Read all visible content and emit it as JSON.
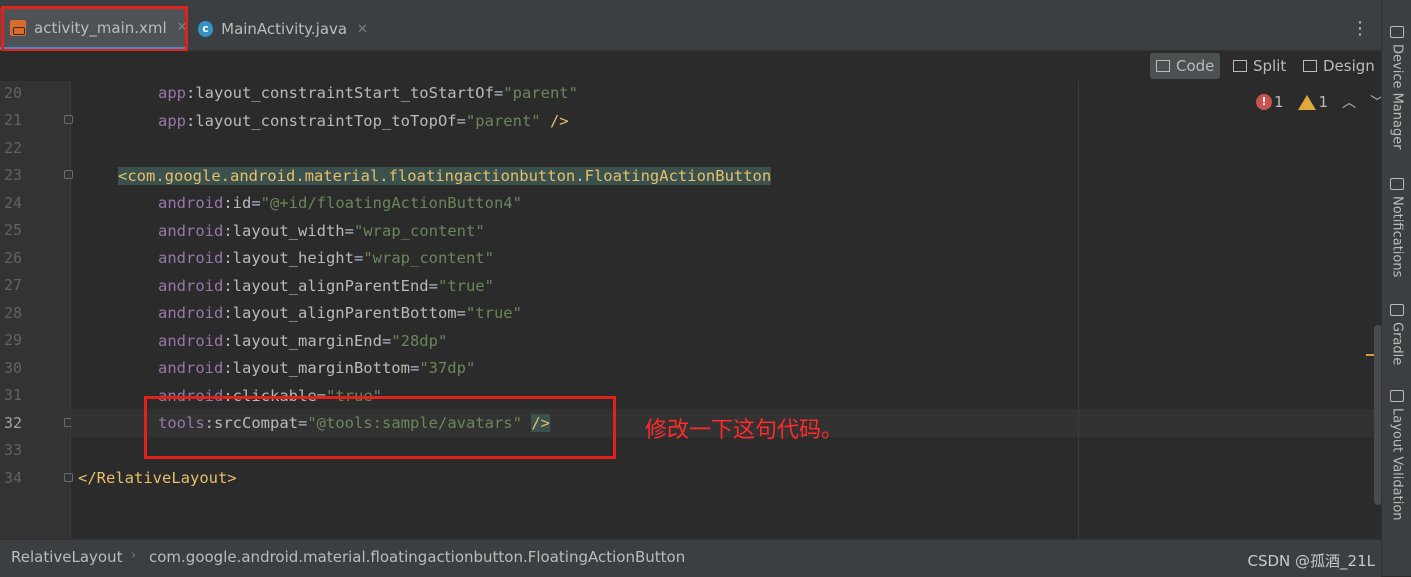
{
  "tabs": [
    {
      "label": "activity_main.xml",
      "active": true
    },
    {
      "label": "MainActivity.java",
      "active": false
    }
  ],
  "modes": [
    "Code",
    "Split",
    "Design"
  ],
  "inspection": {
    "errors": "1",
    "warnings": "1"
  },
  "line_numbers": [
    "20",
    "21",
    "22",
    "23",
    "24",
    "25",
    "26",
    "27",
    "28",
    "29",
    "30",
    "31",
    "32",
    "33",
    "34"
  ],
  "code": {
    "l20": {
      "ns": "app",
      "attr": ":layout_constraintStart_toStartOf",
      "eq": "=",
      "val": "\"parent\""
    },
    "l21": {
      "ns": "app",
      "attr": ":layout_constraintTop_toTopOf",
      "eq": "=",
      "val": "\"parent\"",
      "end": " />"
    },
    "l23": {
      "tag": "<com.google.android.material.floatingactionbutton.FloatingActionButton"
    },
    "l24": {
      "ns": "android",
      "attr": ":id",
      "eq": "=",
      "val": "\"@+id/floatingActionButton4\""
    },
    "l25": {
      "ns": "android",
      "attr": ":layout_width",
      "eq": "=",
      "val": "\"wrap_content\""
    },
    "l26": {
      "ns": "android",
      "attr": ":layout_height",
      "eq": "=",
      "val": "\"wrap_content\""
    },
    "l27": {
      "ns": "android",
      "attr": ":layout_alignParentEnd",
      "eq": "=",
      "val": "\"true\""
    },
    "l28": {
      "ns": "android",
      "attr": ":layout_alignParentBottom",
      "eq": "=",
      "val": "\"true\""
    },
    "l29": {
      "ns": "android",
      "attr": ":layout_marginEnd",
      "eq": "=",
      "val": "\"28dp\""
    },
    "l30": {
      "ns": "android",
      "attr": ":layout_marginBottom",
      "eq": "=",
      "val": "\"37dp\""
    },
    "l31": {
      "ns": "android",
      "attr": ":clickable",
      "eq": "=",
      "val": "\"true\""
    },
    "l32": {
      "ns": "tools",
      "attr": ":srcCompat",
      "eq": "=",
      "val": "\"@tools:sample/avatars\"",
      "end": "/>"
    },
    "l34": {
      "tag": "</RelativeLayout>"
    }
  },
  "annotation": "修改一下这句代码。",
  "breadcrumb": [
    "RelativeLayout",
    "com.google.android.material.floatingactionbutton.FloatingActionButton"
  ],
  "watermark": "CSDN @孤酒_21L",
  "side_tabs": [
    "Device Manager",
    "Notifications",
    "Gradle",
    "Layout Validation"
  ]
}
